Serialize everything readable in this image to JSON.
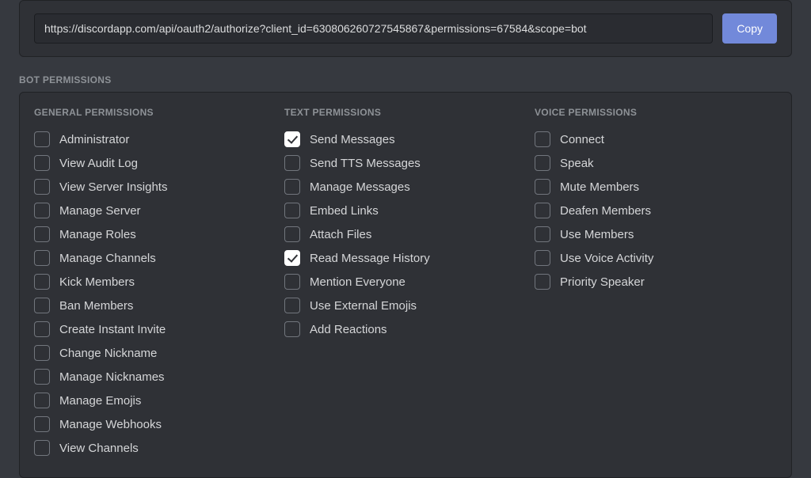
{
  "oauth": {
    "url": "https://discordapp.com/api/oauth2/authorize?client_id=630806260727545867&permissions=67584&scope=bot",
    "copy_label": "Copy"
  },
  "section_title": "BOT PERMISSIONS",
  "columns": {
    "general": {
      "title": "GENERAL PERMISSIONS",
      "items": [
        {
          "label": "Administrator",
          "checked": false
        },
        {
          "label": "View Audit Log",
          "checked": false
        },
        {
          "label": "View Server Insights",
          "checked": false
        },
        {
          "label": "Manage Server",
          "checked": false
        },
        {
          "label": "Manage Roles",
          "checked": false
        },
        {
          "label": "Manage Channels",
          "checked": false
        },
        {
          "label": "Kick Members",
          "checked": false
        },
        {
          "label": "Ban Members",
          "checked": false
        },
        {
          "label": "Create Instant Invite",
          "checked": false
        },
        {
          "label": "Change Nickname",
          "checked": false
        },
        {
          "label": "Manage Nicknames",
          "checked": false
        },
        {
          "label": "Manage Emojis",
          "checked": false
        },
        {
          "label": "Manage Webhooks",
          "checked": false
        },
        {
          "label": "View Channels",
          "checked": false
        }
      ]
    },
    "text": {
      "title": "TEXT PERMISSIONS",
      "items": [
        {
          "label": "Send Messages",
          "checked": true
        },
        {
          "label": "Send TTS Messages",
          "checked": false
        },
        {
          "label": "Manage Messages",
          "checked": false
        },
        {
          "label": "Embed Links",
          "checked": false
        },
        {
          "label": "Attach Files",
          "checked": false
        },
        {
          "label": "Read Message History",
          "checked": true
        },
        {
          "label": "Mention Everyone",
          "checked": false
        },
        {
          "label": "Use External Emojis",
          "checked": false
        },
        {
          "label": "Add Reactions",
          "checked": false
        }
      ]
    },
    "voice": {
      "title": "VOICE PERMISSIONS",
      "items": [
        {
          "label": "Connect",
          "checked": false
        },
        {
          "label": "Speak",
          "checked": false
        },
        {
          "label": "Mute Members",
          "checked": false
        },
        {
          "label": "Deafen Members",
          "checked": false
        },
        {
          "label": "Use Members",
          "checked": false
        },
        {
          "label": "Use Voice Activity",
          "checked": false
        },
        {
          "label": "Priority Speaker",
          "checked": false
        }
      ]
    }
  }
}
